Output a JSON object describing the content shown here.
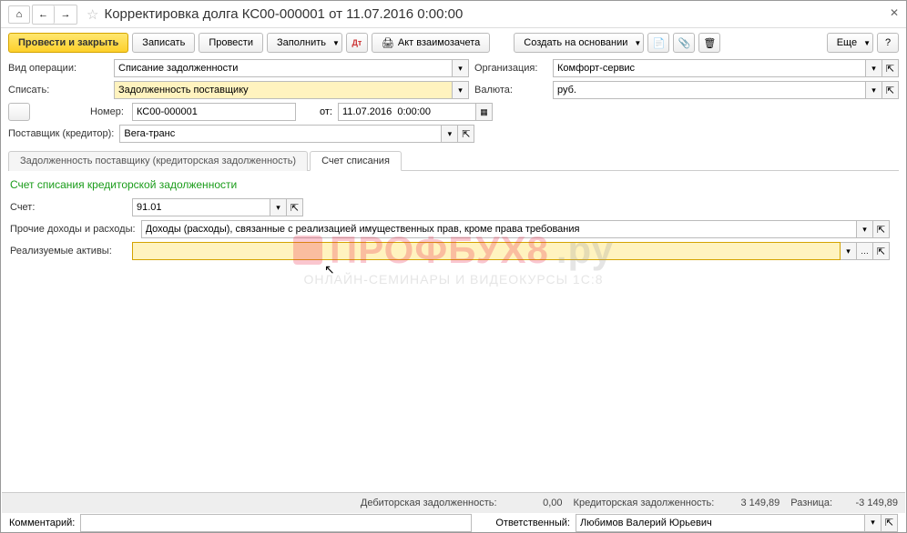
{
  "title": "Корректировка долга КС00-000001 от 11.07.2016 0:00:00",
  "toolbar": {
    "post_and_close": "Провести и закрыть",
    "save": "Записать",
    "post": "Провести",
    "fill": "Заполнить",
    "offset_act": "Акт взаимозачета",
    "create_based": "Создать на основании",
    "more": "Еще"
  },
  "fields": {
    "operation_type_label": "Вид операции:",
    "operation_type": "Списание задолженности",
    "organization_label": "Организация:",
    "organization": "Комфорт-сервис",
    "writeoff_label": "Списать:",
    "writeoff": "Задолженность поставщику",
    "currency_label": "Валюта:",
    "currency": "руб.",
    "number_label": "Номер:",
    "number": "КС00-000001",
    "date_label": "от:",
    "date": "11.07.2016  0:00:00",
    "supplier_label": "Поставщик (кредитор):",
    "supplier": "Вега-транс"
  },
  "tabs": {
    "tab1": "Задолженность поставщику (кредиторская задолженность)",
    "tab2": "Счет списания"
  },
  "writeoff_section": {
    "title": "Счет списания кредиторской задолженности",
    "account_label": "Счет:",
    "account": "91.01",
    "other_income_label": "Прочие доходы и расходы:",
    "other_income": "Доходы (расходы), связанные с реализацией имущественных прав, кроме права требования",
    "assets_label": "Реализуемые активы:",
    "assets": ""
  },
  "footer": {
    "debit_label": "Дебиторская задолженность:",
    "debit_value": "0,00",
    "credit_label": "Кредиторская задолженность:",
    "credit_value": "3 149,89",
    "diff_label": "Разница:",
    "diff_value": "-3 149,89",
    "comment_label": "Комментарий:",
    "comment": "",
    "responsible_label": "Ответственный:",
    "responsible": "Любимов Валерий Юрьевич"
  },
  "watermark": {
    "line1a": "ПРОФБУХ8",
    "line1b": ".ру",
    "line2": "ОНЛАЙН-СЕМИНАРЫ И ВИДЕОКУРСЫ 1С:8"
  }
}
